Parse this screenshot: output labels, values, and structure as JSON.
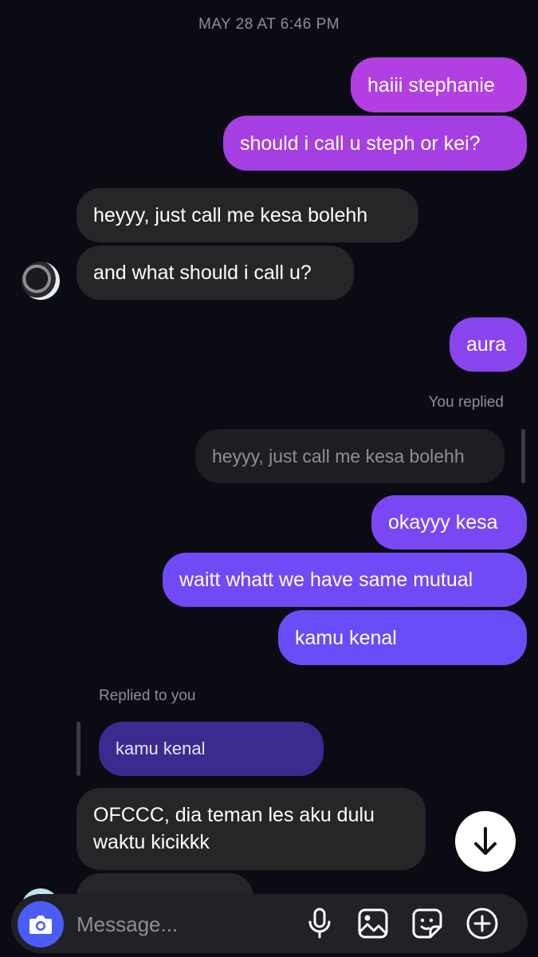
{
  "thread": {
    "timestamp": "MAY 28 AT 6:46 PM"
  },
  "messages": [
    {
      "from": "me",
      "text": "haiii stephanie"
    },
    {
      "from": "me",
      "text": "should i call u steph or kei?"
    },
    {
      "from": "them",
      "text": "heyyy, just call me kesa bolehh"
    },
    {
      "from": "them",
      "text": "and what should i call u?"
    },
    {
      "from": "me",
      "text": "aura"
    },
    {
      "from": "me",
      "text": "okayyy kesa"
    },
    {
      "from": "me",
      "text": "waitt whatt we have same mutual"
    },
    {
      "from": "me",
      "text": "kamu kenal"
    },
    {
      "from": "them",
      "text": "OFCCC, dia teman les aku dulu waktu kicikkk"
    }
  ],
  "reply_out": {
    "label": "You replied",
    "quoted": "heyyy, just call me kesa bolehh"
  },
  "reply_in": {
    "label": "Replied to you",
    "quoted": "kamu kenal"
  },
  "composer": {
    "placeholder": "Message...",
    "icons": [
      "camera-icon",
      "microphone-icon",
      "gallery-icon",
      "sticker-icon",
      "plus-circle-icon"
    ]
  },
  "scroll_button": {
    "icon": "arrow-down-icon"
  },
  "colors": {
    "background": "#0b0b14",
    "incoming_bubble": "#262629",
    "outgoing_top": "#b23ee0",
    "outgoing_bottom": "#6a4cf6",
    "camera_button": "#4a5cf5"
  }
}
